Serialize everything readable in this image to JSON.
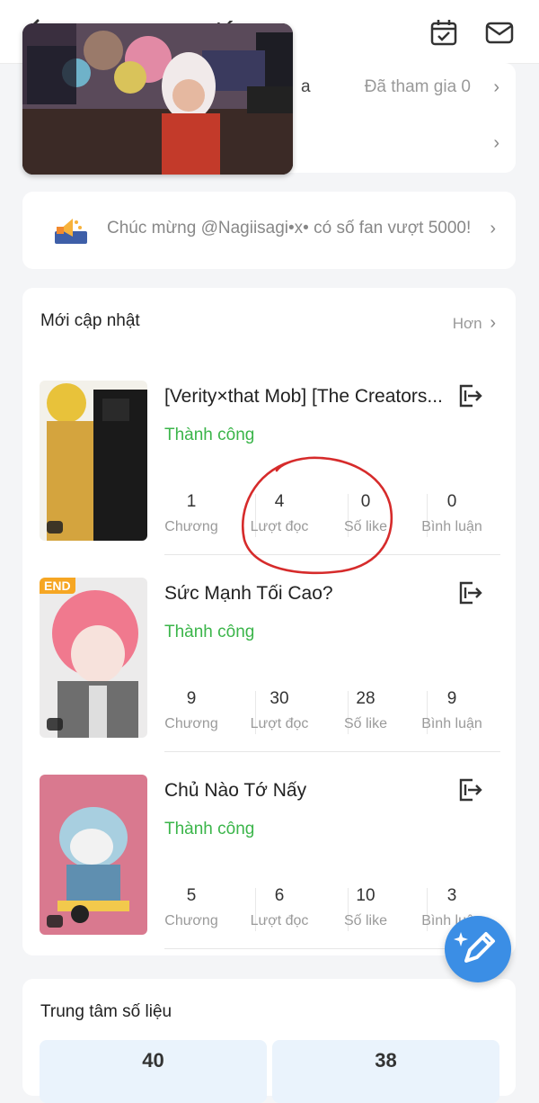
{
  "header": {
    "title": "ng tác"
  },
  "top_card": {
    "row1_name": "a",
    "row1_value": "Đã tham gia 0",
    "chevron": "›"
  },
  "notice": {
    "text": "Chúc mừng @Nagiisagi•x• có số fan vượt 5000!",
    "chevron": "›"
  },
  "updates": {
    "title": "Mới cập nhật",
    "more_label": "Hơn",
    "more_chevron": "›",
    "stories": [
      {
        "title": "[Verity×that Mob] [The Creators...",
        "status": "Thành công",
        "stats": [
          {
            "num": "1",
            "label": "Chương"
          },
          {
            "num": "4",
            "label": "Lượt đọc"
          },
          {
            "num": "0",
            "label": "Số like"
          },
          {
            "num": "0",
            "label": "Bình luận"
          }
        ]
      },
      {
        "title": "Sức Mạnh Tối Cao?",
        "status": "Thành công",
        "badge": "END",
        "stats": [
          {
            "num": "9",
            "label": "Chương"
          },
          {
            "num": "30",
            "label": "Lượt đọc"
          },
          {
            "num": "28",
            "label": "Số like"
          },
          {
            "num": "9",
            "label": "Bình luận"
          }
        ]
      },
      {
        "title": "Chủ Nào Tớ Nấy",
        "status": "Thành công",
        "stats": [
          {
            "num": "5",
            "label": "Chương"
          },
          {
            "num": "6",
            "label": "Lượt đọc"
          },
          {
            "num": "10",
            "label": "Số like"
          },
          {
            "num": "3",
            "label": "Bình luận"
          }
        ]
      }
    ]
  },
  "data_center": {
    "title": "Trung tâm số liệu",
    "values": [
      "40",
      "38"
    ]
  },
  "colors": {
    "success": "#3bb54a",
    "fab": "#3b8ee5",
    "annotation_circle": "#d62b2b"
  }
}
